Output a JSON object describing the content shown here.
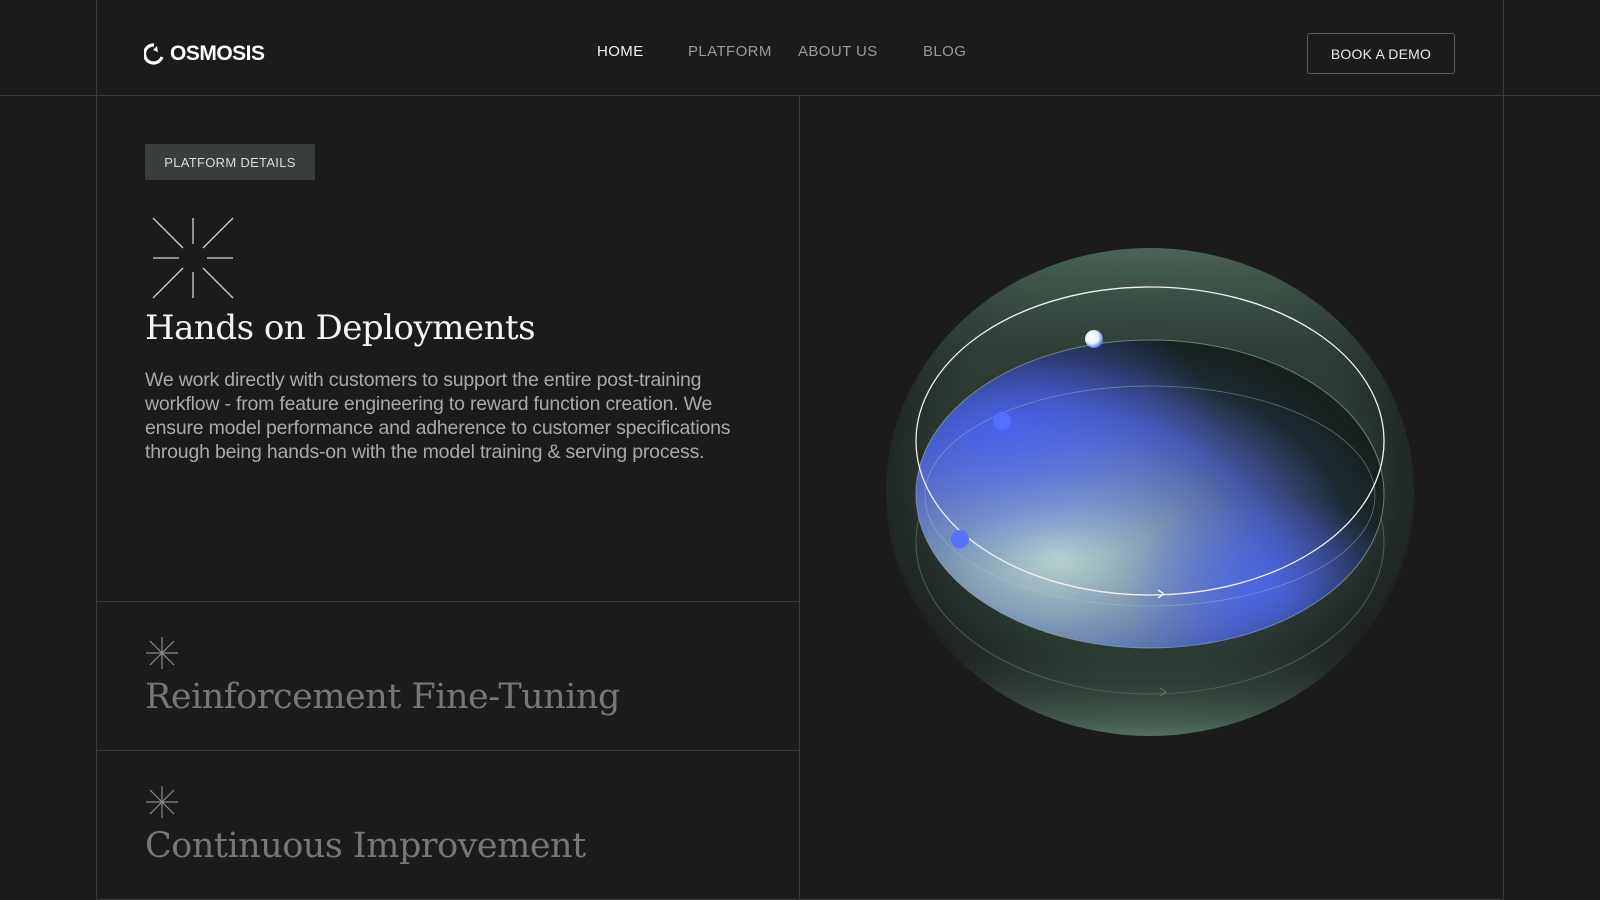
{
  "brand": {
    "name": "OSMOSIS"
  },
  "nav": {
    "items": [
      {
        "label": "HOME",
        "active": true
      },
      {
        "label": "PLATFORM",
        "active": false
      },
      {
        "label": "ABOUT US",
        "active": false
      },
      {
        "label": "BLOG",
        "active": false
      }
    ],
    "cta_label": "BOOK A DEMO"
  },
  "main": {
    "badge": "PLATFORM DETAILS",
    "title": "Hands on Deployments",
    "description": "We work directly with customers to support the entire post-training workflow - from feature engineering to reward function creation. We ensure model performance and adherence to customer specifications through being hands-on with the model training & serving process.",
    "features": [
      {
        "title": "Reinforcement Fine-Tuning"
      },
      {
        "title": "Continuous Improvement"
      }
    ]
  },
  "theme": {
    "background": "#1b1b1b",
    "border": "#3a3a3a",
    "accent_blue": "#4a6cff",
    "accent_green": "#9fc9b0"
  }
}
